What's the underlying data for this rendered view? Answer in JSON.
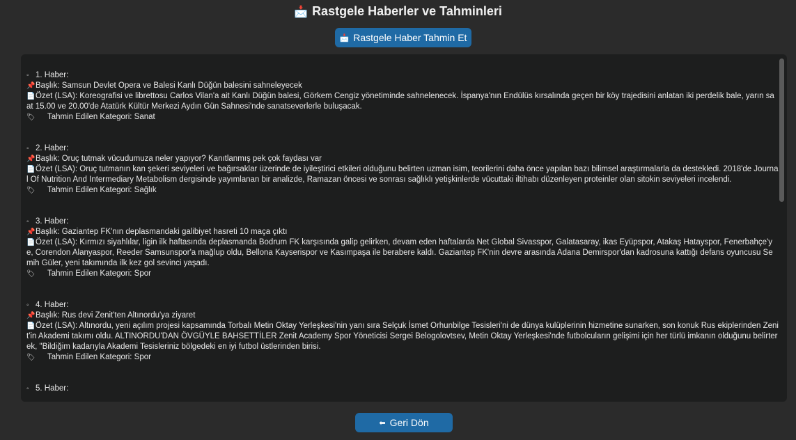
{
  "header": {
    "icon": "envelope-icon",
    "icon_glyph": "📩",
    "title": "Rastgele Haberler ve Tahminleri"
  },
  "predict_button": {
    "icon": "envelope-icon",
    "icon_glyph": "📩",
    "label": "Rastgele Haber Tahmin Et"
  },
  "back_button": {
    "icon": "back-arrow-icon",
    "icon_glyph": "⬅",
    "label": "Geri Dön"
  },
  "news": [
    {
      "heading": "1. Haber:",
      "title": "Başlık: Samsun Devlet Opera ve Balesi Kanlı Düğün balesini sahneleyecek",
      "summary": "Özet (LSA): Koreografisi ve librettosu Carlos Vilan'a ait Kanlı Düğün balesi, Görkem Cengiz yönetiminde sahnelenecek. İspanya'nın Endülüs kırsalında geçen bir köy trajedisini anlatan iki perdelik bale, yarın saat 15.00 ve 20.00'de Atatürk Kültür Merkezi Aydın Gün Sahnesi'nde sanatseverlerle buluşacak.",
      "category": "Tahmin Edilen Kategori: Sanat"
    },
    {
      "heading": "2. Haber:",
      "title": "Başlık: Oruç tutmak vücudumuza neler yapıyor? Kanıtlanmış pek çok faydası var",
      "summary": "Özet (LSA): Oruç tutmanın kan şekeri seviyeleri ve bağırsaklar üzerinde de iyileştirici etkileri olduğunu belirten uzman isim, teorilerini daha önce yapılan bazı bilimsel araştırmalarla da destekledi. 2018'de Journal Of Nutrition And Intermediary Metabolism dergisinde yayımlanan bir analizde, Ramazan öncesi ve sonrası sağlıklı yetişkinlerde vücuttaki iltihabı düzenleyen proteinler olan sitokin seviyeleri incelendi.",
      "category": "Tahmin Edilen Kategori: Sağlık"
    },
    {
      "heading": "3. Haber:",
      "title": "Başlık: Gaziantep FK'nın deplasmandaki galibiyet hasreti 10 maça çıktı",
      "summary": "Özet (LSA): Kırmızı siyahlılar, ligin ilk haftasında deplasmanda Bodrum FK karşısında galip gelirken, devam eden haftalarda Net Global Sivasspor, Galatasaray, ikas Eyüpspor, Atakaş Hatayspor, Fenerbahçe'ye, Corendon Alanyaspor, Reeder Samsunspor'a mağlup oldu, Bellona Kayserispor ve Kasımpaşa ile berabere kaldı. Gaziantep FK'nin devre arasında Adana Demirspor'dan kadrosuna kattığı defans oyuncusu Semih Güler, yeni takımında ilk kez gol sevinci yaşadı.",
      "category": "Tahmin Edilen Kategori: Spor"
    },
    {
      "heading": "4. Haber:",
      "title": "Başlık: Rus devi Zenit'ten Altınordu'ya ziyaret",
      "summary": "Özet (LSA): Altınordu, yeni açılım projesi kapsamında Torbalı Metin Oktay Yerleşkesi'nin yanı sıra Selçuk İsmet Orhunbilge Tesisleri'ni de dünya kulüplerinin hizmetine sunarken, son konuk Rus ekiplerinden Zenit'in Akademi takımı oldu. ALTINORDU'DAN ÖVGÜYLE BAHSETTİLER   Zenit Academy Spor Yöneticisi Sergei Belogolovtsev, Metin Oktay Yerleşkesi'nde futbolcuların gelişimi için her türlü imkanın olduğunu belirterek, \"Bildiğim kadarıyla Akademi Tesisleriniz bölgedeki en iyi futbol üstlerinden birisi.",
      "category": "Tahmin Edilen Kategori: Spor"
    },
    {
      "heading": "5. Haber:",
      "title": "",
      "summary": "",
      "category": ""
    }
  ],
  "icons": {
    "bullet": "◦",
    "pin": "📌",
    "doc": "📄",
    "tag": "🏷"
  }
}
